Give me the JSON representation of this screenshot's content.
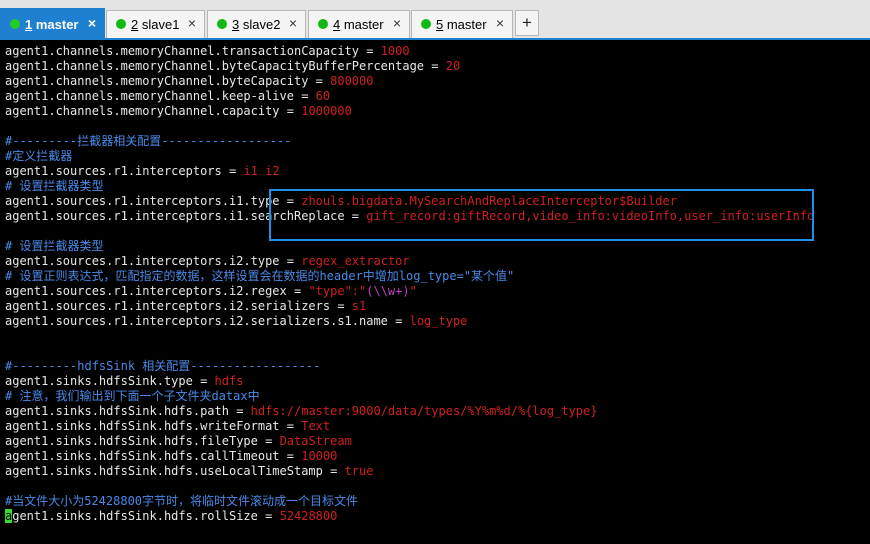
{
  "tabs": [
    {
      "num": "1",
      "label": " master",
      "close": "×",
      "active": true
    },
    {
      "num": "2",
      "label": " slave1",
      "close": "×",
      "active": false
    },
    {
      "num": "3",
      "label": " slave2",
      "close": "×",
      "active": false
    },
    {
      "num": "4",
      "label": " master",
      "close": "×",
      "active": false
    },
    {
      "num": "5",
      "label": " master",
      "close": "×",
      "active": false
    }
  ],
  "new_tab_label": "+",
  "colors": {
    "active_tab": "#1f7fd0",
    "status_dot": "#22cc22",
    "value": "#d02020",
    "comment": "#4a8ae8",
    "highlight_box": "#1e90e8",
    "cursor": "#33dd33"
  },
  "lines": {
    "l1": {
      "k": "agent1.channels.memoryChannel.transactionCapacity",
      "eq": " = ",
      "v": "1000"
    },
    "l2": {
      "k": "agent1.channels.memoryChannel.byteCapacityBufferPercentage",
      "eq": " = ",
      "v": "20"
    },
    "l3": {
      "k": "agent1.channels.memoryChannel.byteCapacity",
      "eq": " = ",
      "v": "800000"
    },
    "l4": {
      "k": "agent1.channels.memoryChannel.keep-alive",
      "eq": " = ",
      "v": "60"
    },
    "l5": {
      "k": "agent1.channels.memoryChannel.capacity",
      "eq": " = ",
      "v": "1000000"
    },
    "c1": "#---------拦截器相关配置------------------",
    "c2": "#定义拦截器",
    "l6": {
      "k": "agent1.sources.r1.interceptors",
      "eq": " = ",
      "v": "i1 i2"
    },
    "c3": "# 设置拦截器类型",
    "l7": {
      "k": "agent1.sources.r1.interceptors.i1.type",
      "eq": " = ",
      "v": "zhouls.bigdata.MySearchAndReplaceInterceptor$Builder"
    },
    "l8": {
      "k": "agent1.sources.r1.interceptors.i1.searchReplace",
      "eq": " = ",
      "v": "gift_record:giftRecord,video_info:videoInfo,user_info:userInfo"
    },
    "c4": "# 设置拦截器类型",
    "l9": {
      "k": "agent1.sources.r1.interceptors.i2.type",
      "eq": " = ",
      "v": "regex_extractor"
    },
    "c5": "# 设置正则表达式，匹配指定的数据，这样设置会在数据的header中增加log_type=\"某个值\"",
    "l10": {
      "k": "agent1.sources.r1.interceptors.i2.regex",
      "eq": " = ",
      "v1": "\"type\":\"",
      "v2": "(\\\\w+)",
      "v3": "\""
    },
    "l11": {
      "k": "agent1.sources.r1.interceptors.i2.serializers",
      "eq": " = ",
      "v": "s1"
    },
    "l12": {
      "k": "agent1.sources.r1.interceptors.i2.serializers.s1.name",
      "eq": " = ",
      "v": "log_type"
    },
    "c6": "#---------hdfsSink 相关配置------------------",
    "l13": {
      "k": "agent1.sinks.hdfsSink.type",
      "eq": " = ",
      "v": "hdfs"
    },
    "c7": "# 注意，我们输出到下面一个子文件夹datax中",
    "l14": {
      "k": "agent1.sinks.hdfsSink.hdfs.path",
      "eq": " = ",
      "v": "hdfs://master:9000/data/types/%Y%m%d/%{log_type}"
    },
    "l15": {
      "k": "agent1.sinks.hdfsSink.hdfs.writeFormat",
      "eq": " = ",
      "v": "Text"
    },
    "l16": {
      "k": "agent1.sinks.hdfsSink.hdfs.fileType",
      "eq": " = ",
      "v": "DataStream"
    },
    "l17": {
      "k": "agent1.sinks.hdfsSink.hdfs.callTimeout",
      "eq": " = ",
      "v": "10000"
    },
    "l18": {
      "k": "agent1.sinks.hdfsSink.hdfs.useLocalTimeStamp",
      "eq": " = ",
      "v": "true"
    },
    "c8": "#当文件大小为52428800字节时，将临时文件滚动成一个目标文件",
    "l19": {
      "cursor": "a",
      "k": "gent1.sinks.hdfsSink.hdfs.rollSize",
      "eq": " = ",
      "v": "52428800"
    }
  }
}
